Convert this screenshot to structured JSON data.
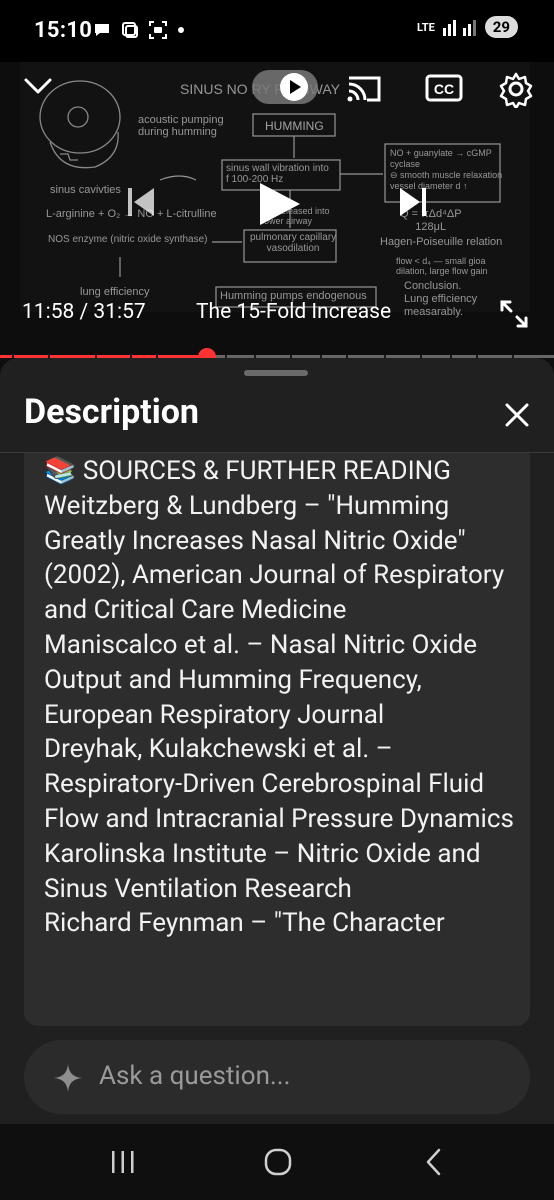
{
  "status_bar": {
    "time": "15:10",
    "network": "LTE",
    "battery": "29"
  },
  "video": {
    "timecode": "11:58 / 31:57",
    "chapter": "The 15-Fold Increase",
    "progress_fraction": 0.373,
    "accent_color": "#ff3333",
    "icons": [
      "chevron-down-icon",
      "play-toggle-icon",
      "cast-icon",
      "cc-icon",
      "gear-icon",
      "previous-icon",
      "play-icon",
      "next-icon",
      "fullscreen-icon"
    ],
    "slide": {
      "title": "SINUS NO       RY PATHWAY",
      "humming": "HUMMING",
      "acoustic": "acoustic pumping\nduring humming",
      "sinus_cavities": "sinus cavivties",
      "arginine": "L-arginine + O₂ → NO + L-citrulline",
      "nos": "NOS enzyme (nitric oxide synthase)",
      "lung": "lung efficiency",
      "wall": "sinus wall vibration into\nf 100-200 Hz",
      "released": "NO released into\nlower airway",
      "capillary": "pulmonary capillary\nvasodilation",
      "pumps": "Humming pumps endogenous",
      "guanylate": "NO + guanylate → cGMP\ncyclase\n⊖ smooth muscle relaxation\nvessel diameter d ↑",
      "formula": "Q = πΔd⁴ΔP\n     128μL",
      "hagen": "Hagen-Poiseuille relation",
      "flow": "flow < d₄ — small gioa\ndilation, large flow gain",
      "conclusion": "Conclusion.\nLung efficiency\nmeasarably."
    }
  },
  "description": {
    "title": "Description",
    "text": "📚 SOURCES & FURTHER READING\nWeitzberg & Lundberg – \"Humming Greatly Increases Nasal Nitric Oxide\" (2002), American Journal of Respiratory and Critical Care Medicine\nManiscalco et al. – Nasal Nitric Oxide Output and Humming Frequency, European Respiratory Journal\nDreyhak, Kulakchewski et al. – Respiratory-Driven Cerebrospinal Fluid Flow and Intracranial Pressure Dynamics\nKarolinska Institute – Nitric Oxide and Sinus Ventilation Research\nRichard Feynman – \"The Character"
  },
  "ask": {
    "placeholder": "Ask a question..."
  },
  "nav": {
    "icons": [
      "recents-icon",
      "home-icon",
      "back-icon"
    ]
  }
}
